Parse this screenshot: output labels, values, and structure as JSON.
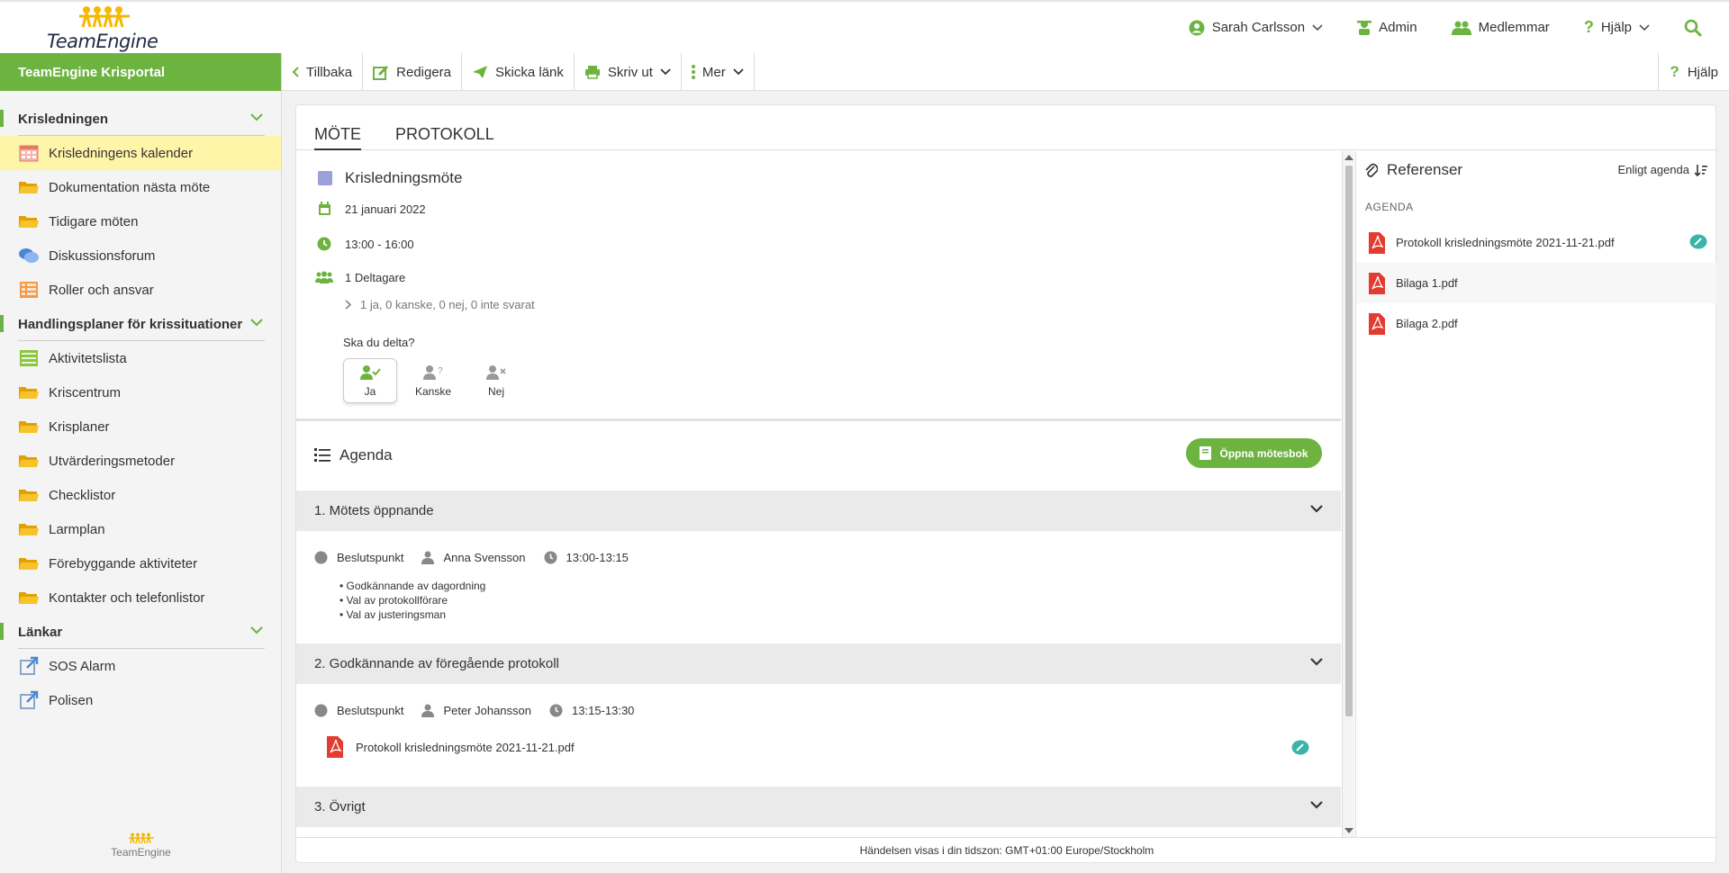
{
  "header": {
    "logo_text": "TeamEngine",
    "user": "Sarah Carlsson",
    "admin": "Admin",
    "members": "Medlemmar",
    "help": "Hjälp"
  },
  "sidebar": {
    "portal": "TeamEngine Krisportal",
    "sections": [
      {
        "title": "Krisledningen",
        "items": [
          {
            "label": "Krisledningens kalender",
            "icon": "calendar-icon",
            "active": true
          },
          {
            "label": "Dokumentation nästa möte",
            "icon": "folder-icon"
          },
          {
            "label": "Tidigare möten",
            "icon": "folder-icon"
          },
          {
            "label": "Diskussionsforum",
            "icon": "chat-icon"
          },
          {
            "label": "Roller och ansvar",
            "icon": "table-icon"
          }
        ]
      },
      {
        "title": "Handlingsplaner för krissituationer",
        "items": [
          {
            "label": "Aktivitetslista",
            "icon": "list-icon"
          },
          {
            "label": "Kriscentrum",
            "icon": "folder-icon"
          },
          {
            "label": "Krisplaner",
            "icon": "folder-icon"
          },
          {
            "label": "Utvärderingsmetoder",
            "icon": "folder-icon"
          },
          {
            "label": "Checklistor",
            "icon": "folder-icon"
          },
          {
            "label": "Larmplan",
            "icon": "folder-icon"
          },
          {
            "label": "Förebyggande aktiviteter",
            "icon": "folder-icon"
          },
          {
            "label": "Kontakter och telefonlistor",
            "icon": "folder-icon"
          }
        ]
      },
      {
        "title": "Länkar",
        "items": [
          {
            "label": "SOS Alarm",
            "icon": "external-link-icon"
          },
          {
            "label": "Polisen",
            "icon": "external-link-icon"
          }
        ]
      }
    ],
    "footer_logo": "TeamEngine"
  },
  "toolbar": {
    "back": "Tillbaka",
    "edit": "Redigera",
    "send_link": "Skicka länk",
    "print": "Skriv ut",
    "more": "Mer",
    "help": "Hjälp"
  },
  "tabs": [
    "MÖTE",
    "PROTOKOLL"
  ],
  "meeting": {
    "title": "Krisledningsmöte",
    "date": "21 januari 2022",
    "time": "13:00 - 16:00",
    "participants": "1 Deltagare",
    "answers": "1 ja, 0 kanske, 0 nej, 0 inte svarat",
    "question": "Ska du delta?",
    "rsvp": {
      "yes": "Ja",
      "maybe": "Kanske",
      "no": "Nej"
    }
  },
  "agenda": {
    "title": "Agenda",
    "open_book": "Öppna mötesbok",
    "items": [
      {
        "title": "1. Mötets öppnande",
        "type": "Beslutspunkt",
        "person": "Anna Svensson",
        "time": "13:00-13:15",
        "bullets": [
          "• Godkännande av dagordning",
          "• Val av protokollförare",
          "• Val av justeringsman"
        ]
      },
      {
        "title": "2. Godkännande av föregående protokoll",
        "type": "Beslutspunkt",
        "person": "Peter Johansson",
        "time": "13:15-13:30",
        "attachment": "Protokoll krisledningsmöte 2021-11-21.pdf"
      },
      {
        "title": "3. Övrigt"
      }
    ]
  },
  "references": {
    "title": "Referenser",
    "sort": "Enligt agenda",
    "subheading": "AGENDA",
    "files": [
      "Protokoll krisledningsmöte 2021-11-21.pdf",
      "Bilaga 1.pdf",
      "Bilaga 2.pdf"
    ]
  },
  "timezone_note": "Händelsen visas i din tidszon: GMT+01:00 Europe/Stockholm",
  "colors": {
    "accent": "#6cb33f",
    "active_nav": "#fff5a8",
    "pdf": "#e23b30",
    "folder": "#f5b800",
    "teal": "#3ab3a8"
  }
}
